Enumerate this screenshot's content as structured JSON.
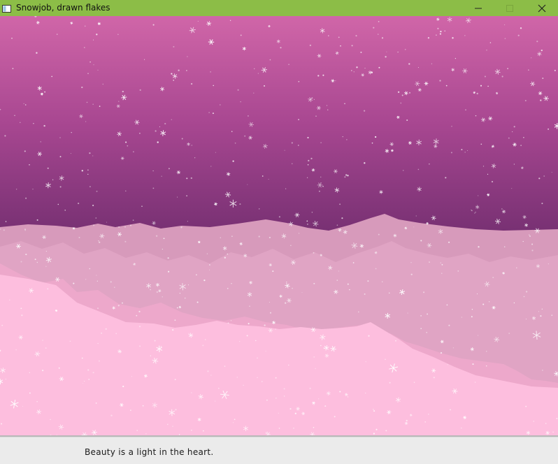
{
  "window": {
    "title": "Snowjob, drawn flakes",
    "controls": [
      {
        "name": "minimize",
        "icon": "minimize-icon"
      },
      {
        "name": "maximize",
        "icon": "maximize-icon"
      },
      {
        "name": "close",
        "icon": "close-icon"
      }
    ]
  },
  "scene": {
    "description_icon": "snow-scene",
    "colors": {
      "sky_top": "#d066a8",
      "sky_bottom": "#6e2c6d",
      "ridge_far": "#d79abb",
      "ridge_mid": "#e0a4c4",
      "ridge_near": "#eda8cb",
      "foreground": "#fdbede",
      "flake": "#ffffff",
      "titlebar": "#8cbd47"
    }
  },
  "status": {
    "message": "Beauty is a light in the heart."
  }
}
